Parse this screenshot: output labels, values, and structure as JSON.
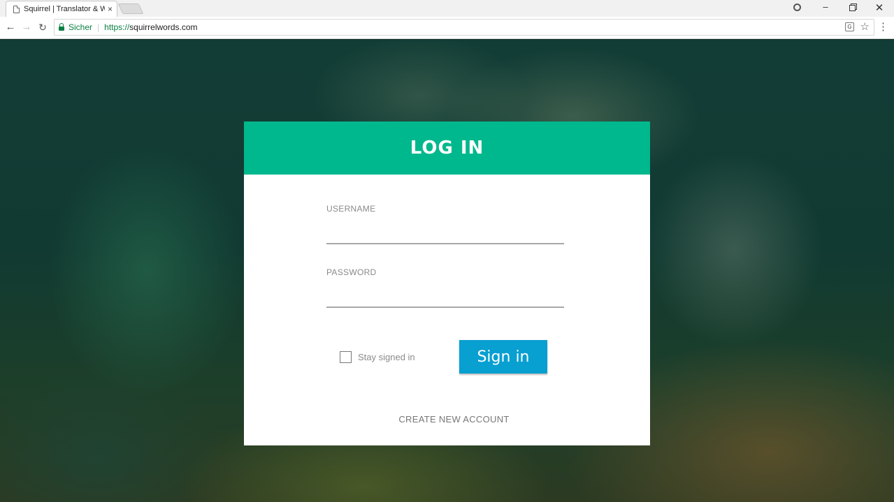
{
  "browser": {
    "tab_title": "Squirrel | Translator & W",
    "tab_close": "×",
    "secure_label": "Sicher",
    "url_scheme": "https://",
    "url_host": "squirrelwords.com",
    "icons": [
      "page-icon",
      "back-icon",
      "forward-icon",
      "reload-icon",
      "lock-icon",
      "translate-icon",
      "star-icon",
      "menu-icon",
      "profile-icon"
    ]
  },
  "login": {
    "title": "LOG IN",
    "username_label": "USERNAME",
    "username_value": "",
    "password_label": "PASSWORD",
    "password_value": "",
    "stay_signed_in_label": "Stay signed in",
    "stay_signed_in_checked": false,
    "sign_in_label": "Sign in",
    "create_account_label": "CREATE NEW ACCOUNT"
  },
  "colors": {
    "header_green": "#00b88d",
    "button_blue": "#089fd1",
    "secure_green": "#0b8043"
  }
}
